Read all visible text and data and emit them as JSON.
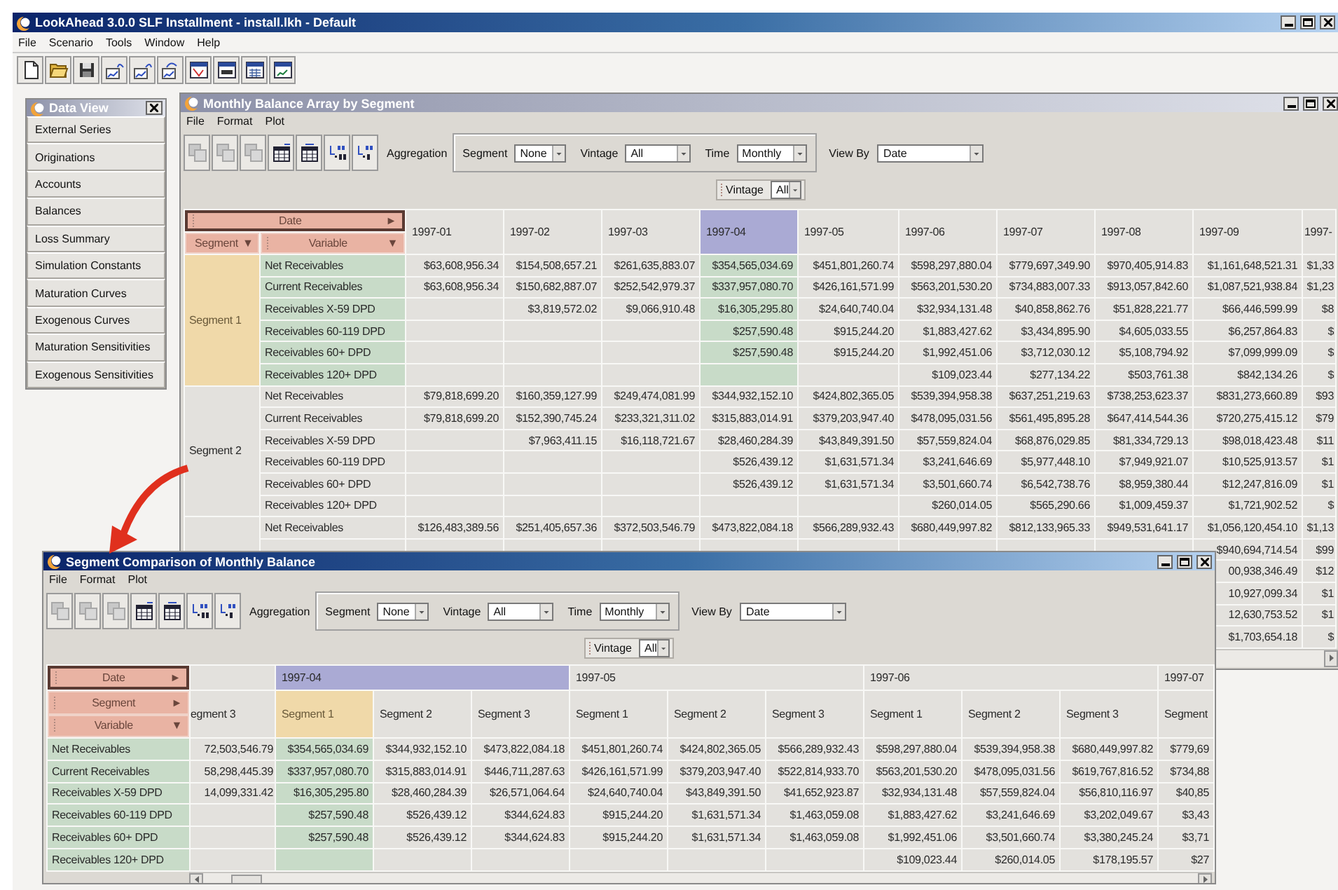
{
  "app": {
    "title": "LookAhead 3.0.0 SLF Installment - install.lkh - Default",
    "menu": [
      "File",
      "Scenario",
      "Tools",
      "Window",
      "Help"
    ],
    "tools": [
      {
        "kind": "new"
      },
      {
        "kind": "open"
      },
      {
        "kind": "save"
      },
      {
        "kind": "chart-in"
      },
      {
        "kind": "chart-out"
      },
      {
        "kind": "chart-swap"
      },
      {
        "kind": "window-red"
      },
      {
        "kind": "window-bars"
      },
      {
        "kind": "window-grid"
      },
      {
        "kind": "window-plot"
      }
    ]
  },
  "data_view": {
    "title": "Data View",
    "active": false,
    "items": [
      "External Series",
      "Originations",
      "Accounts",
      "Balances",
      "Loss Summary",
      "Simulation Constants",
      "Maturation Curves",
      "Exogenous Curves",
      "Maturation Sensitivities",
      "Exogenous Sensitivities"
    ]
  },
  "balance_window": {
    "title": "Monthly Balance Array by Segment",
    "active": false,
    "menu": [
      "File",
      "Format",
      "Plot"
    ],
    "tools": [
      {
        "kind": "copy",
        "disabled": true
      },
      {
        "kind": "copy",
        "disabled": true
      },
      {
        "kind": "copy",
        "disabled": true
      },
      {
        "kind": "table-add",
        "disabled": false
      },
      {
        "kind": "table-move",
        "disabled": false
      },
      {
        "kind": "decimal-more",
        "disabled": false
      },
      {
        "kind": "decimal-less",
        "disabled": false
      }
    ],
    "aggregation_label": "Aggregation",
    "filters": [
      {
        "label": "Segment",
        "value": "None"
      },
      {
        "label": "Vintage",
        "value": "All"
      },
      {
        "label": "Time",
        "value": "Monthly"
      }
    ],
    "view_by": {
      "label": "View By",
      "value": "Date"
    },
    "vintage_filter": {
      "label": "Vintage",
      "value": "All"
    },
    "table": {
      "pivot_fields": [
        {
          "label": "Date",
          "arrow": "►",
          "selected": true
        },
        {
          "label": "Segment",
          "arrow": "▼",
          "selected": false
        },
        {
          "label": "Variable",
          "arrow": "▼",
          "selected": false
        }
      ],
      "columns": [
        {
          "label": "1997-01",
          "selected": false
        },
        {
          "label": "1997-02",
          "selected": false
        },
        {
          "label": "1997-03",
          "selected": false
        },
        {
          "label": "1997-04",
          "selected": true
        },
        {
          "label": "1997-05",
          "selected": false
        },
        {
          "label": "1997-06",
          "selected": false
        },
        {
          "label": "1997-07",
          "selected": false
        },
        {
          "label": "1997-08",
          "selected": false
        },
        {
          "label": "1997-09",
          "selected": false
        },
        {
          "label": "1997-",
          "selected": false
        }
      ],
      "groups": [
        {
          "label": "Segment 1",
          "selected": true,
          "rows": [
            {
              "variable": "Net Receivables",
              "selected": true,
              "cells": [
                {
                  "value": "$63,608,956.34"
                },
                {
                  "value": "$154,508,657.21"
                },
                {
                  "value": "$261,635,883.07"
                },
                {
                  "value": "$354,565,034.69"
                },
                {
                  "value": "$451,801,260.74"
                },
                {
                  "value": "$598,297,880.04"
                },
                {
                  "value": "$779,697,349.90"
                },
                {
                  "value": "$970,405,914.83"
                },
                {
                  "value": "$1,161,648,521.31"
                },
                {
                  "value": "$1,33"
                }
              ]
            },
            {
              "variable": "Current Receivables",
              "selected": true,
              "cells": [
                {
                  "value": "$63,608,956.34"
                },
                {
                  "value": "$150,682,887.07"
                },
                {
                  "value": "$252,542,979.37"
                },
                {
                  "value": "$337,957,080.70"
                },
                {
                  "value": "$426,161,571.99"
                },
                {
                  "value": "$563,201,530.20"
                },
                {
                  "value": "$734,883,007.33"
                },
                {
                  "value": "$913,057,842.60"
                },
                {
                  "value": "$1,087,521,938.84"
                },
                {
                  "value": "$1,23"
                }
              ]
            },
            {
              "variable": "Receivables X-59 DPD",
              "selected": true,
              "cells": [
                {},
                {
                  "value": "$3,819,572.02"
                },
                {
                  "value": "$9,066,910.48"
                },
                {
                  "value": "$16,305,295.80"
                },
                {
                  "value": "$24,640,740.04"
                },
                {
                  "value": "$32,934,131.48"
                },
                {
                  "value": "$40,858,862.76"
                },
                {
                  "value": "$51,828,221.77"
                },
                {
                  "value": "$66,446,599.99"
                },
                {
                  "value": "$8"
                }
              ]
            },
            {
              "variable": "Receivables 60-119 DPD",
              "selected": true,
              "cells": [
                {},
                {},
                {},
                {
                  "value": "$257,590.48"
                },
                {
                  "value": "$915,244.20"
                },
                {
                  "value": "$1,883,427.62"
                },
                {
                  "value": "$3,434,895.90"
                },
                {
                  "value": "$4,605,033.55"
                },
                {
                  "value": "$6,257,864.83"
                },
                {
                  "value": "$"
                }
              ]
            },
            {
              "variable": "Receivables 60+ DPD",
              "selected": true,
              "cells": [
                {},
                {},
                {},
                {
                  "value": "$257,590.48"
                },
                {
                  "value": "$915,244.20"
                },
                {
                  "value": "$1,992,451.06"
                },
                {
                  "value": "$3,712,030.12"
                },
                {
                  "value": "$5,108,794.92"
                },
                {
                  "value": "$7,099,999.09"
                },
                {
                  "value": "$"
                }
              ]
            },
            {
              "variable": "Receivables 120+ DPD",
              "selected": true,
              "cells": [
                {},
                {},
                {},
                {},
                {},
                {
                  "value": "$109,023.44"
                },
                {
                  "value": "$277,134.22"
                },
                {
                  "value": "$503,761.38"
                },
                {
                  "value": "$842,134.26"
                },
                {
                  "value": "$"
                }
              ]
            }
          ]
        },
        {
          "label": "Segment 2",
          "selected": false,
          "rows": [
            {
              "variable": "Net Receivables",
              "selected": false,
              "cells": [
                {
                  "value": "$79,818,699.20"
                },
                {
                  "value": "$160,359,127.99"
                },
                {
                  "value": "$249,474,081.99"
                },
                {
                  "value": "$344,932,152.10"
                },
                {
                  "value": "$424,802,365.05"
                },
                {
                  "value": "$539,394,958.38"
                },
                {
                  "value": "$637,251,219.63"
                },
                {
                  "value": "$738,253,623.37"
                },
                {
                  "value": "$831,273,660.89"
                },
                {
                  "value": "$93"
                }
              ]
            },
            {
              "variable": "Current Receivables",
              "selected": false,
              "cells": [
                {
                  "value": "$79,818,699.20"
                },
                {
                  "value": "$152,390,745.24"
                },
                {
                  "value": "$233,321,311.02"
                },
                {
                  "value": "$315,883,014.91"
                },
                {
                  "value": "$379,203,947.40"
                },
                {
                  "value": "$478,095,031.56"
                },
                {
                  "value": "$561,495,895.28"
                },
                {
                  "value": "$647,414,544.36"
                },
                {
                  "value": "$720,275,415.12"
                },
                {
                  "value": "$79"
                }
              ]
            },
            {
              "variable": "Receivables X-59 DPD",
              "selected": false,
              "cells": [
                {},
                {
                  "value": "$7,963,411.15"
                },
                {
                  "value": "$16,118,721.67"
                },
                {
                  "value": "$28,460,284.39"
                },
                {
                  "value": "$43,849,391.50"
                },
                {
                  "value": "$57,559,824.04"
                },
                {
                  "value": "$68,876,029.85"
                },
                {
                  "value": "$81,334,729.13"
                },
                {
                  "value": "$98,018,423.48"
                },
                {
                  "value": "$11"
                }
              ]
            },
            {
              "variable": "Receivables 60-119 DPD",
              "selected": false,
              "cells": [
                {},
                {},
                {},
                {
                  "value": "$526,439.12"
                },
                {
                  "value": "$1,631,571.34"
                },
                {
                  "value": "$3,241,646.69"
                },
                {
                  "value": "$5,977,448.10"
                },
                {
                  "value": "$7,949,921.07"
                },
                {
                  "value": "$10,525,913.57"
                },
                {
                  "value": "$1"
                }
              ]
            },
            {
              "variable": "Receivables 60+ DPD",
              "selected": false,
              "cells": [
                {},
                {},
                {},
                {
                  "value": "$526,439.12"
                },
                {
                  "value": "$1,631,571.34"
                },
                {
                  "value": "$3,501,660.74"
                },
                {
                  "value": "$6,542,738.76"
                },
                {
                  "value": "$8,959,380.44"
                },
                {
                  "value": "$12,247,816.09"
                },
                {
                  "value": "$1"
                }
              ]
            },
            {
              "variable": "Receivables 120+ DPD",
              "selected": false,
              "cells": [
                {},
                {},
                {},
                {},
                {},
                {
                  "value": "$260,014.05"
                },
                {
                  "value": "$565,290.66"
                },
                {
                  "value": "$1,009,459.37"
                },
                {
                  "value": "$1,721,902.52"
                },
                {
                  "value": "$"
                }
              ]
            }
          ]
        },
        {
          "selected": false,
          "rows": [
            {
              "variable": "Net Receivables",
              "selected": false,
              "cells": [
                {
                  "value": "$126,483,389.56"
                },
                {
                  "value": "$251,405,657.36"
                },
                {
                  "value": "$372,503,546.79"
                },
                {
                  "value": "$473,822,084.18"
                },
                {
                  "value": "$566,289,932.43"
                },
                {
                  "value": "$680,449,997.82"
                },
                {
                  "value": "$812,133,965.33"
                },
                {
                  "value": "$949,531,641.17"
                },
                {
                  "value": "$1,056,120,454.10"
                },
                {
                  "value": "$1,13"
                }
              ]
            },
            {
              "cells": [
                {},
                {},
                {},
                {},
                {},
                {},
                {},
                {},
                {
                  "value": "$940,694,714.54"
                },
                {
                  "value": "$99"
                }
              ]
            },
            {
              "cells": [
                {},
                {},
                {},
                {},
                {},
                {},
                {},
                {},
                {
                  "value": "00,938,346.49"
                },
                {
                  "value": "$12"
                }
              ]
            },
            {
              "cells": [
                {},
                {},
                {},
                {},
                {},
                {},
                {},
                {},
                {
                  "value": "10,927,099.34"
                },
                {
                  "value": "$1"
                }
              ]
            },
            {
              "cells": [
                {},
                {},
                {},
                {},
                {},
                {},
                {},
                {},
                {
                  "value": "12,630,753.52"
                },
                {
                  "value": "$1"
                }
              ]
            },
            {
              "cells": [
                {},
                {},
                {},
                {},
                {},
                {},
                {},
                {},
                {
                  "value": "$1,703,654.18"
                },
                {
                  "value": "$"
                }
              ]
            }
          ]
        }
      ]
    }
  },
  "comparison_window": {
    "title": "Segment Comparison of Monthly Balance",
    "active": true,
    "menu": [
      "File",
      "Format",
      "Plot"
    ],
    "tools": [
      {
        "kind": "copy",
        "disabled": true
      },
      {
        "kind": "copy",
        "disabled": true
      },
      {
        "kind": "copy",
        "disabled": true
      },
      {
        "kind": "table-add",
        "disabled": false
      },
      {
        "kind": "table-move",
        "disabled": false
      },
      {
        "kind": "decimal-more",
        "disabled": false
      },
      {
        "kind": "decimal-less",
        "disabled": false
      }
    ],
    "aggregation_label": "Aggregation",
    "filters": [
      {
        "label": "Segment",
        "value": "None"
      },
      {
        "label": "Vintage",
        "value": "All"
      },
      {
        "label": "Time",
        "value": "Monthly"
      }
    ],
    "view_by": {
      "label": "View By",
      "value": "Date"
    },
    "vintage_filter": {
      "label": "Vintage",
      "value": "All"
    },
    "table": {
      "pivot_fields": [
        {
          "label": "Date",
          "arrow": "►",
          "selected": true
        },
        {
          "label": "Segment",
          "arrow": "►",
          "selected": false
        },
        {
          "label": "Variable",
          "arrow": "▼",
          "selected": false
        }
      ],
      "date_groups": [
        {
          "selected": false,
          "segments": [
            {
              "label": "egment 3",
              "selected": false
            }
          ]
        },
        {
          "label": "1997-04",
          "selected": true,
          "segments": [
            {
              "label": "Segment 1",
              "selected": true
            },
            {
              "label": "Segment 2",
              "selected": false
            },
            {
              "label": "Segment 3",
              "selected": false
            }
          ]
        },
        {
          "label": "1997-05",
          "selected": false,
          "segments": [
            {
              "label": "Segment 1",
              "selected": false
            },
            {
              "label": "Segment 2",
              "selected": false
            },
            {
              "label": "Segment 3",
              "selected": false
            }
          ]
        },
        {
          "label": "1997-06",
          "selected": false,
          "segments": [
            {
              "label": "Segment 1",
              "selected": false
            },
            {
              "label": "Segment 2",
              "selected": false
            },
            {
              "label": "Segment 3",
              "selected": false
            }
          ]
        },
        {
          "label": "1997-07",
          "selected": false,
          "segments": [
            {
              "label": "Segment",
              "selected": false
            }
          ]
        }
      ],
      "rows": [
        {
          "variable": "Net Receivables",
          "selected": true,
          "cells": [
            {
              "value": "72,503,546.79"
            },
            {
              "value": "$354,565,034.69"
            },
            {
              "value": "$344,932,152.10"
            },
            {
              "value": "$473,822,084.18"
            },
            {
              "value": "$451,801,260.74"
            },
            {
              "value": "$424,802,365.05"
            },
            {
              "value": "$566,289,932.43"
            },
            {
              "value": "$598,297,880.04"
            },
            {
              "value": "$539,394,958.38"
            },
            {
              "value": "$680,449,997.82"
            },
            {
              "value": "$779,69"
            }
          ]
        },
        {
          "variable": "Current Receivables",
          "selected": true,
          "cells": [
            {
              "value": "58,298,445.39"
            },
            {
              "value": "$337,957,080.70"
            },
            {
              "value": "$315,883,014.91"
            },
            {
              "value": "$446,711,287.63"
            },
            {
              "value": "$426,161,571.99"
            },
            {
              "value": "$379,203,947.40"
            },
            {
              "value": "$522,814,933.70"
            },
            {
              "value": "$563,201,530.20"
            },
            {
              "value": "$478,095,031.56"
            },
            {
              "value": "$619,767,816.52"
            },
            {
              "value": "$734,88"
            }
          ]
        },
        {
          "variable": "Receivables X-59 DPD",
          "selected": true,
          "cells": [
            {
              "value": "14,099,331.42"
            },
            {
              "value": "$16,305,295.80"
            },
            {
              "value": "$28,460,284.39"
            },
            {
              "value": "$26,571,064.64"
            },
            {
              "value": "$24,640,740.04"
            },
            {
              "value": "$43,849,391.50"
            },
            {
              "value": "$41,652,923.87"
            },
            {
              "value": "$32,934,131.48"
            },
            {
              "value": "$57,559,824.04"
            },
            {
              "value": "$56,810,116.97"
            },
            {
              "value": "$40,85"
            }
          ]
        },
        {
          "variable": "Receivables 60-119 DPD",
          "selected": true,
          "cells": [
            {},
            {
              "value": "$257,590.48"
            },
            {
              "value": "$526,439.12"
            },
            {
              "value": "$344,624.83"
            },
            {
              "value": "$915,244.20"
            },
            {
              "value": "$1,631,571.34"
            },
            {
              "value": "$1,463,059.08"
            },
            {
              "value": "$1,883,427.62"
            },
            {
              "value": "$3,241,646.69"
            },
            {
              "value": "$3,202,049.67"
            },
            {
              "value": "$3,43"
            }
          ]
        },
        {
          "variable": "Receivables 60+ DPD",
          "selected": true,
          "cells": [
            {},
            {
              "value": "$257,590.48"
            },
            {
              "value": "$526,439.12"
            },
            {
              "value": "$344,624.83"
            },
            {
              "value": "$915,244.20"
            },
            {
              "value": "$1,631,571.34"
            },
            {
              "value": "$1,463,059.08"
            },
            {
              "value": "$1,992,451.06"
            },
            {
              "value": "$3,501,660.74"
            },
            {
              "value": "$3,380,245.24"
            },
            {
              "value": "$3,71"
            }
          ]
        },
        {
          "variable": "Receivables 120+ DPD",
          "selected": true,
          "cells": [
            {},
            {},
            {},
            {},
            {},
            {},
            {},
            {
              "value": "$109,023.44"
            },
            {
              "value": "$260,014.05"
            },
            {
              "value": "$178,195.57"
            },
            {
              "value": "$27"
            }
          ]
        }
      ]
    }
  }
}
